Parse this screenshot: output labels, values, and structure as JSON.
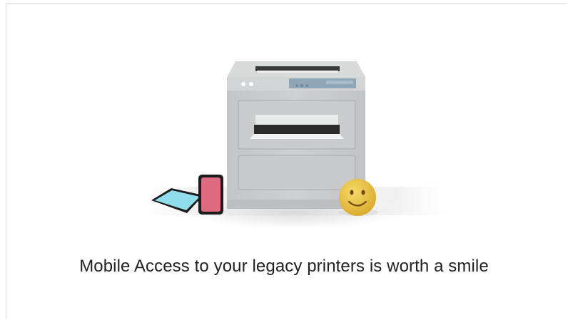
{
  "caption": {
    "text": "Mobile Access to your legacy printers is worth a smile"
  },
  "icons": {
    "printer": "printer-icon",
    "tablet": "tablet-icon",
    "phone": "smartphone-icon",
    "smiley": "smiley-face-icon"
  },
  "colors": {
    "printer_body": "#c9cacb",
    "printer_top": "#dcdddd",
    "control_panel": "#8fa6b6",
    "tablet": "#8fdcec",
    "phone": "#dd6a80",
    "smiley": "#e8c042",
    "caption_text": "#222222"
  }
}
